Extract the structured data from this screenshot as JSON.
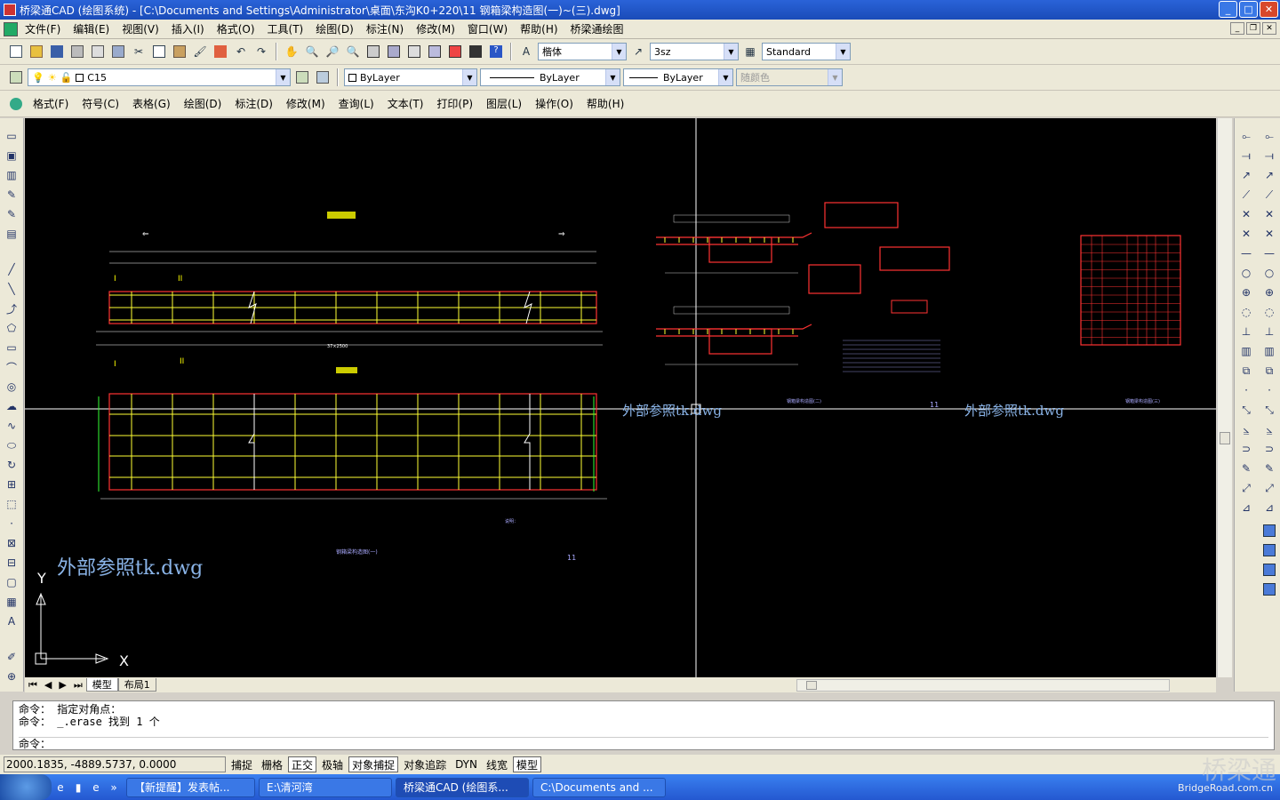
{
  "window": {
    "title": "桥梁通CAD (绘图系统) - [C:\\Documents and Settings\\Administrator\\桌面\\东沟K0+220\\11 钢箱梁构造图(一)~(三).dwg]"
  },
  "menu": [
    "文件(F)",
    "编辑(E)",
    "视图(V)",
    "插入(I)",
    "格式(O)",
    "工具(T)",
    "绘图(D)",
    "标注(N)",
    "修改(M)",
    "窗口(W)",
    "帮助(H)",
    "桥梁通绘图"
  ],
  "menu2": [
    "格式(F)",
    "符号(C)",
    "表格(G)",
    "绘图(D)",
    "标注(D)",
    "修改(M)",
    "查询(L)",
    "文本(T)",
    "打印(P)",
    "图层(L)",
    "操作(O)",
    "帮助(H)"
  ],
  "toolbar": {
    "text_style": "楷体",
    "dim_style": "3sz",
    "plot_style": "Standard",
    "layer": "C15",
    "color": "ByLayer",
    "linetype": "ByLayer",
    "lineweight": "ByLayer",
    "plotcolor": "随颜色"
  },
  "drawing": {
    "xref_labels": [
      "外部参照tk.dwg",
      "外部参照tk.dwg",
      "外部参照tk.dwg"
    ],
    "axis_y": "Y",
    "axis_x": "X",
    "page_num_1": "11",
    "page_num_2": "11",
    "dim_total": "37×2500"
  },
  "tabs": [
    "模型",
    "布局1"
  ],
  "command": {
    "line1": "命令： 指定对角点：",
    "line2": "命令： _.erase 找到 1 个",
    "line3": "命令："
  },
  "status": {
    "coords": "2000.1835, -4889.5737, 0.0000",
    "buttons": [
      "捕捉",
      "栅格",
      "正交",
      "极轴",
      "对象捕捉",
      "对象追踪",
      "DYN",
      "线宽",
      "模型"
    ]
  },
  "taskbar": [
    "【新提醒】发表帖...",
    "E:\\清河湾",
    "桥梁通CAD (绘图系...",
    "C:\\Documents and ..."
  ],
  "watermark": {
    "big": "桥梁通",
    "small": "BridgeRoad.com.cn"
  }
}
